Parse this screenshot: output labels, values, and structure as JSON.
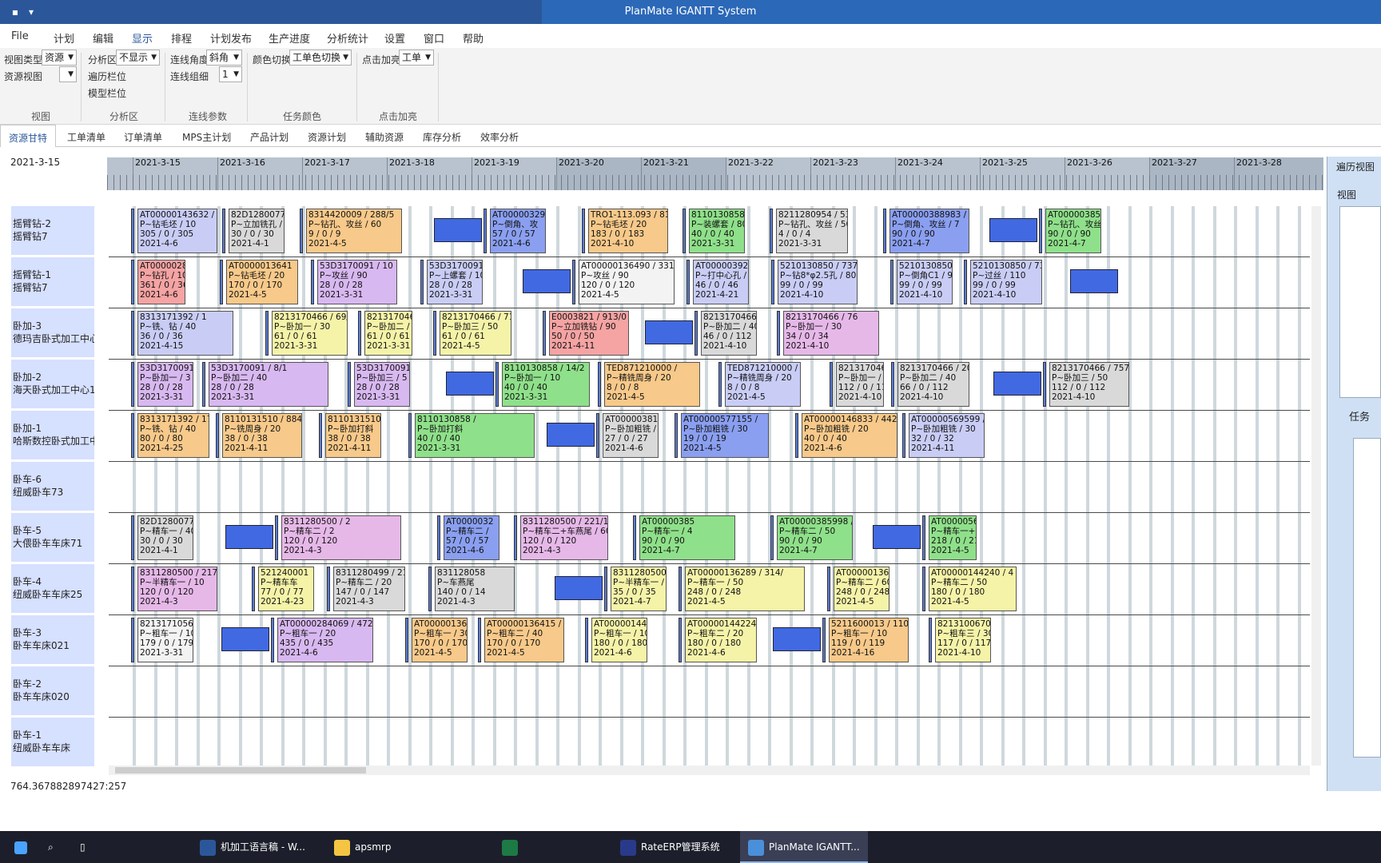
{
  "window": {
    "title": "PlanMate IGANTT System"
  },
  "menu": [
    "File",
    "计划",
    "编辑",
    "显示",
    "排程",
    "计划发布",
    "生产进度",
    "分析统计",
    "设置",
    "窗口",
    "帮助"
  ],
  "ribbon": {
    "view_type_label": "视图类型",
    "view_type_value": "资源",
    "resource_view_label": "资源视图",
    "resource_view_value": "",
    "analysis_label": "分析区",
    "analysis_value": "不显示",
    "traverse_label": "遍历栏位",
    "model_label": "模型栏位",
    "angle_label": "连线角度",
    "angle_value": "斜角",
    "group_label": "连线组细",
    "group_value": "1",
    "color_label": "颜色切换",
    "color_value": "工单色切换",
    "highlight_label": "点击加亮",
    "highlight_value": "工单",
    "groups": [
      "视图",
      "分析区",
      "连线参数",
      "任务颜色",
      "点击加亮"
    ]
  },
  "tabs": [
    "资源甘特",
    "工单清单",
    "订单清单",
    "MPS主计划",
    "产品计划",
    "资源计划",
    "辅助资源",
    "库存分析",
    "效率分析"
  ],
  "current_date": "2021-3-15",
  "timeline": [
    "2021-3-15",
    "2021-3-16",
    "2021-3-17",
    "2021-3-18",
    "2021-3-19",
    "2021-3-20",
    "2021-3-21",
    "2021-3-22",
    "2021-3-23",
    "2021-3-24",
    "2021-3-25",
    "2021-3-26",
    "2021-3-27",
    "2021-3-28"
  ],
  "resources": [
    {
      "l1": "摇臂钻-2",
      "l2": "摇臂钻7"
    },
    {
      "l1": "摇臂钻-1",
      "l2": "摇臂钻7"
    },
    {
      "l1": "卧加-3",
      "l2": "德玛吉卧式加工中心"
    },
    {
      "l1": "卧加-2",
      "l2": "海天卧式加工中心1"
    },
    {
      "l1": "卧加-1",
      "l2": "哈斯数控卧式加工中"
    },
    {
      "l1": "卧车-6",
      "l2": "纽威卧车73"
    },
    {
      "l1": "卧车-5",
      "l2": "大偎卧车车床71"
    },
    {
      "l1": "卧车-4",
      "l2": "纽威卧车车床25"
    },
    {
      "l1": "卧车-3",
      "l2": "卧车车床021"
    },
    {
      "l1": "卧车-2",
      "l2": "卧车车床020"
    },
    {
      "l1": "卧车-1",
      "l2": "纽威卧车车床"
    }
  ],
  "tasks": [
    {
      "row": 0,
      "t1": "AT00000143632 / 4",
      "t2": "P~钻毛坯 / 10",
      "t3": "305 / 0 / 305",
      "t4": "2021-4-6",
      "c": "#c9cdf5"
    },
    {
      "row": 0,
      "t1": "82D1280077 / 83/1",
      "t2": "P~立加铣孔 / 60",
      "t3": "30 / 0 / 30",
      "t4": "2021-4-1",
      "c": "#d9d9d9"
    },
    {
      "row": 0,
      "t1": "8314420009 / 288/5",
      "t2": "P~钻孔、攻丝 / 60",
      "t3": "9 / 0 / 9",
      "t4": "2021-4-5",
      "c": "#f7c98a"
    },
    {
      "row": 0,
      "t1": "AT000003291",
      "t2": "P~倒角、攻",
      "t3": "57 / 0 / 57",
      "t4": "2021-4-6",
      "c": "#8a9ff0"
    },
    {
      "row": 0,
      "t1": "TRO1-113.093 / 815/",
      "t2": "P~钻毛坯 / 20",
      "t3": "183 / 0 / 183",
      "t4": "2021-4-10",
      "c": "#f7c98a"
    },
    {
      "row": 0,
      "t1": "8110130858 / 17/2",
      "t2": "P~装螺套 / 80",
      "t3": "40 / 0 / 40",
      "t4": "2021-3-31",
      "c": "#8fe08a"
    },
    {
      "row": 0,
      "t1": "8211280954 / 53/9",
      "t2": "P~钻孔、攻丝 / 50",
      "t3": "4 / 0 / 4",
      "t4": "2021-3-31",
      "c": "#d9d9d9"
    },
    {
      "row": 0,
      "t1": "AT00000388983 /",
      "t2": "P~倒角、攻丝 / 7",
      "t3": "90 / 0 / 90",
      "t4": "2021-4-7",
      "c": "#8a9ff0"
    },
    {
      "row": 0,
      "t1": "AT00000385998 / 570/",
      "t2": "P~钻孔、攻丝 / 50",
      "t3": "90 / 0 / 90",
      "t4": "2021-4-7",
      "c": "#8fe08a"
    },
    {
      "row": 1,
      "t1": "AT00000284069 / 46",
      "t2": "P~钻孔 / 10",
      "t3": "361 / 0 / 361",
      "t4": "2021-4-6",
      "c": "#f5a3a3"
    },
    {
      "row": 1,
      "t1": "AT0000013641",
      "t2": "P~钻毛坯 / 20",
      "t3": "170 / 0 / 170",
      "t4": "2021-4-5",
      "c": "#f7c98a"
    },
    {
      "row": 1,
      "t1": "53D3170091 / 10",
      "t2": "P~攻丝 / 90",
      "t3": "28 / 0 / 28",
      "t4": "2021-3-31",
      "c": "#d8b8f0"
    },
    {
      "row": 1,
      "t1": "53D3170091 / 11",
      "t2": "P~上螺套 / 100",
      "t3": "28 / 0 / 28",
      "t4": "2021-3-31",
      "c": "#c9cdf5"
    },
    {
      "row": 1,
      "t1": "AT00000136490 / 331/14",
      "t2": "P~攻丝 / 90",
      "t3": "120 / 0 / 120",
      "t4": "2021-4-5",
      "c": "#f3f3f3"
    },
    {
      "row": 1,
      "t1": "AT000003921",
      "t2": "P~打中心孔 / 1",
      "t3": "46 / 0 / 46",
      "t4": "2021-4-21",
      "c": "#c9cdf5"
    },
    {
      "row": 1,
      "t1": "5210130850 / 737/6",
      "t2": "P~钻8*φ2.5孔 / 80",
      "t3": "99 / 0 / 99",
      "t4": "2021-4-10",
      "c": "#c9cdf5"
    },
    {
      "row": 1,
      "t1": "5210130850 / 738/",
      "t2": "P~倒角C1 / 90",
      "t3": "99 / 0 / 99",
      "t4": "2021-4-10",
      "c": "#c9cdf5"
    },
    {
      "row": 1,
      "t1": "5210130850 / 739/6",
      "t2": "P~过丝 / 110",
      "t3": "99 / 0 / 99",
      "t4": "2021-4-10",
      "c": "#c9cdf5"
    },
    {
      "row": 2,
      "t1": "8313171392 / 1",
      "t2": "P~铣、钻 / 40",
      "t3": "36 / 0 / 36",
      "t4": "2021-4-15",
      "c": "#c9cdf5"
    },
    {
      "row": 2,
      "t1": "8213170466 / 69/12",
      "t2": "P~卧加一 / 30",
      "t3": "61 / 0 / 61",
      "t4": "2021-3-31",
      "c": "#f5f3a8"
    },
    {
      "row": 2,
      "t1": "8213170466 / 70/12",
      "t2": "P~卧加二 / 40",
      "t3": "61 / 0 / 61",
      "t4": "2021-3-31",
      "c": "#f5f3a8"
    },
    {
      "row": 2,
      "t1": "8213170466 / 71/12",
      "t2": "P~卧加三 / 50",
      "t3": "61 / 0 / 61",
      "t4": "2021-4-5",
      "c": "#f5f3a8"
    },
    {
      "row": 2,
      "t1": "E0003821 / 913/0",
      "t2": "P~立加铣钻 / 90",
      "t3": "50 / 0 / 50",
      "t4": "2021-4-11",
      "c": "#f5a3a3"
    },
    {
      "row": 2,
      "t1": "8213170466 / 756/9",
      "t2": "P~卧加二 / 40",
      "t3": "46 / 0 / 112",
      "t4": "2021-4-10",
      "c": "#d9d9d9"
    },
    {
      "row": 2,
      "t1": "8213170466 / 76",
      "t2": "P~卧加一 / 30",
      "t3": "34 / 0 / 34",
      "t4": "2021-4-10",
      "c": "#e6b8e8"
    },
    {
      "row": 3,
      "t1": "53D3170091 /",
      "t2": "P~卧加一 / 3",
      "t3": "28 / 0 / 28",
      "t4": "2021-3-31",
      "c": "#d8b8f0"
    },
    {
      "row": 3,
      "t1": "53D3170091 / 8/1",
      "t2": "P~卧加二 / 40",
      "t3": "28 / 0 / 28",
      "t4": "2021-3-31",
      "c": "#d8b8f0"
    },
    {
      "row": 3,
      "t1": "53D3170091 /",
      "t2": "P~卧加三 / 5",
      "t3": "28 / 0 / 28",
      "t4": "2021-3-31",
      "c": "#d8b8f0"
    },
    {
      "row": 3,
      "t1": "8110130858 / 14/2",
      "t2": "P~卧加一 / 10",
      "t3": "40 / 0 / 40",
      "t4": "2021-3-31",
      "c": "#8fe08a"
    },
    {
      "row": 3,
      "t1": "TED871210000 /",
      "t2": "P~精铣周身 / 20",
      "t3": "8 / 0 / 8",
      "t4": "2021-4-5",
      "c": "#f7c98a"
    },
    {
      "row": 3,
      "t1": "TED871210000 /",
      "t2": "P~精铣周身 / 20",
      "t3": "8 / 0 / 8",
      "t4": "2021-4-5",
      "c": "#c9cdf5"
    },
    {
      "row": 3,
      "t1": "8213170466 / 755/9",
      "t2": "P~卧加一 / 30",
      "t3": "112 / 0 / 112",
      "t4": "2021-4-10",
      "c": "#d9d9d9"
    },
    {
      "row": 3,
      "t1": "8213170466 / 2016/9",
      "t2": "P~卧加二 / 40",
      "t3": "66 / 0 / 112",
      "t4": "2021-4-10",
      "c": "#d9d9d9"
    },
    {
      "row": 3,
      "t1": "8213170466 / 757/9",
      "t2": "P~卧加三 / 50",
      "t3": "112 / 0 / 112",
      "t4": "2021-4-10",
      "c": "#d9d9d9"
    },
    {
      "row": 4,
      "t1": "8313171392 / 1768/13",
      "t2": "P~铣、钻 / 40",
      "t3": "80 / 0 / 80",
      "t4": "2021-4-25",
      "c": "#f7c98a"
    },
    {
      "row": 4,
      "t1": "8110131510 / 884/",
      "t2": "P~铣周身 / 20",
      "t3": "38 / 0 / 38",
      "t4": "2021-4-11",
      "c": "#f7c98a"
    },
    {
      "row": 4,
      "t1": "8110131510",
      "t2": "P~卧加打斜",
      "t3": "38 / 0 / 38",
      "t4": "2021-4-11",
      "c": "#f7c98a"
    },
    {
      "row": 4,
      "t1": "8110130858 /",
      "t2": "P~卧加打斜",
      "t3": "40 / 0 / 40",
      "t4": "2021-3-31",
      "c": "#8fe08a"
    },
    {
      "row": 4,
      "t1": "AT00000381793 / 459/",
      "t2": "P~卧加粗铣 / 20",
      "t3": "27 / 0 / 27",
      "t4": "2021-4-6",
      "c": "#d9d9d9"
    },
    {
      "row": 4,
      "t1": "AT00000577155 /",
      "t2": "P~卧加粗铣 / 30",
      "t3": "19 / 0 / 19",
      "t4": "2021-4-5",
      "c": "#8a9ff0"
    },
    {
      "row": 4,
      "t1": "AT00000146833 / 442/13",
      "t2": "P~卧加粗铣 / 20",
      "t3": "40 / 0 / 40",
      "t4": "2021-4-6",
      "c": "#f7c98a"
    },
    {
      "row": 4,
      "t1": "AT00000569599 / 900/15",
      "t2": "P~卧加粗铣 / 30",
      "t3": "32 / 0 / 32",
      "t4": "2021-4-11",
      "c": "#c9cdf5"
    },
    {
      "row": 6,
      "t1": "82D1280077 / 82/15",
      "t2": "P~精车一 / 40",
      "t3": "30 / 0 / 30",
      "t4": "2021-4-1",
      "c": "#d9d9d9"
    },
    {
      "row": 6,
      "t1": "8311280500 / 2",
      "t2": "P~精车二 / 2",
      "t3": "120 / 0 / 120",
      "t4": "2021-4-3",
      "c": "#e6b8e8"
    },
    {
      "row": 6,
      "t1": "AT0000032",
      "t2": "P~精车二 /",
      "t3": "57 / 0 / 57",
      "t4": "2021-4-6",
      "c": "#8a9ff0"
    },
    {
      "row": 6,
      "t1": "8311280500 / 221/10",
      "t2": "P~精车二+车燕尾 / 60",
      "t3": "120 / 0 / 120",
      "t4": "2021-4-3",
      "c": "#e6b8e8"
    },
    {
      "row": 6,
      "t1": "AT00000385",
      "t2": "P~精车一 / 4",
      "t3": "90 / 0 / 90",
      "t4": "2021-4-7",
      "c": "#8fe08a"
    },
    {
      "row": 6,
      "t1": "AT00000385998 / 568/",
      "t2": "P~精车二 / 50",
      "t3": "90 / 0 / 90",
      "t4": "2021-4-7",
      "c": "#8fe08a"
    },
    {
      "row": 6,
      "t1": "AT00000563375 / 351/2",
      "t2": "P~精车一+车燕尾 / 40",
      "t3": "218 / 0 / 218",
      "t4": "2021-4-5",
      "c": "#8fe08a"
    },
    {
      "row": 7,
      "t1": "8311280500 / 217/10",
      "t2": "P~半精车一 / 10",
      "t3": "120 / 0 / 120",
      "t4": "2021-4-3",
      "c": "#e6b8e8"
    },
    {
      "row": 7,
      "t1": "521240001",
      "t2": "P~精车车",
      "t3": "77 / 0 / 77",
      "t4": "2021-4-23",
      "c": "#f5f3a8"
    },
    {
      "row": 7,
      "t1": "8311280499 / 212/9",
      "t2": "P~精车二 / 20",
      "t3": "147 / 0 / 147",
      "t4": "2021-4-3",
      "c": "#d9d9d9"
    },
    {
      "row": 7,
      "t1": "831128058",
      "t2": "P~车燕尾",
      "t3": "140 / 0 / 14",
      "t4": "2021-4-3",
      "c": "#d9d9d9"
    },
    {
      "row": 7,
      "t1": "8311280500 / 2",
      "t2": "P~半精车一 /",
      "t3": "35 / 0 / 35",
      "t4": "2021-4-7",
      "c": "#f5f3a8"
    },
    {
      "row": 7,
      "t1": "AT00000136289 / 314/",
      "t2": "P~精车一 / 50",
      "t3": "248 / 0 / 248",
      "t4": "2021-4-5",
      "c": "#f5f3a8"
    },
    {
      "row": 7,
      "t1": "AT00000136289 / 315/",
      "t2": "P~精车二 / 60",
      "t3": "248 / 0 / 248",
      "t4": "2021-4-5",
      "c": "#f5f3a8"
    },
    {
      "row": 7,
      "t1": "AT00000144240 / 4",
      "t2": "P~精车二 / 50",
      "t3": "180 / 0 / 180",
      "t4": "2021-4-5",
      "c": "#f5f3a8"
    },
    {
      "row": 8,
      "t1": "8213171056 / 76/14",
      "t2": "P~粗车一 / 10",
      "t3": "179 / 0 / 179",
      "t4": "2021-3-31",
      "c": "#f3f3f3"
    },
    {
      "row": 8,
      "t1": "AT00000284069 / 472/1",
      "t2": "P~粗车一 / 20",
      "t3": "435 / 0 / 435",
      "t4": "2021-4-6",
      "c": "#d8b8f0"
    },
    {
      "row": 8,
      "t1": "AT00000136415 / 321/13",
      "t2": "P~粗车一 / 30",
      "t3": "170 / 0 / 170",
      "t4": "2021-4-5",
      "c": "#f7c98a"
    },
    {
      "row": 8,
      "t1": "AT00000136415 / 322",
      "t2": "P~粗车二 / 40",
      "t3": "170 / 0 / 170",
      "t4": "2021-4-5",
      "c": "#f7c98a"
    },
    {
      "row": 8,
      "t1": "AT00000144240 / 435/12",
      "t2": "P~粗车一 / 10",
      "t3": "180 / 0 / 180",
      "t4": "2021-4-6",
      "c": "#f5f3a8"
    },
    {
      "row": 8,
      "t1": "AT00000144224",
      "t2": "P~粗车二 / 20",
      "t3": "180 / 0 / 180",
      "t4": "2021-4-6",
      "c": "#f5f3a8"
    },
    {
      "row": 8,
      "t1": "5211600013 / 1100/",
      "t2": "P~粗车一 / 10",
      "t3": "119 / 0 / 119",
      "t4": "2021-4-16",
      "c": "#f7c98a"
    },
    {
      "row": 8,
      "t1": "8213100670 / 749/",
      "t2": "P~粗车三 / 30",
      "t3": "117 / 0 / 117",
      "t4": "2021-4-10",
      "c": "#f5f3a8"
    }
  ],
  "status": {
    "coord": "764.367882897427:257"
  },
  "sidepanel": {
    "title": "遍历视图",
    "view": "视图",
    "task": "任务"
  },
  "taskbar": [
    "机加工语言稿 - W...",
    "apsmrp",
    "RateERP管理系统",
    "PlanMate IGANTT..."
  ]
}
